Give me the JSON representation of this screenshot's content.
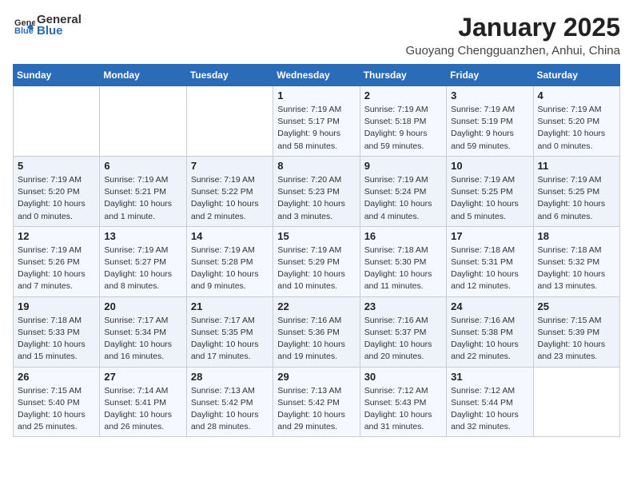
{
  "header": {
    "logo_line1": "General",
    "logo_line2": "Blue",
    "month_title": "January 2025",
    "location": "Guoyang Chengguanzhen, Anhui, China"
  },
  "weekdays": [
    "Sunday",
    "Monday",
    "Tuesday",
    "Wednesday",
    "Thursday",
    "Friday",
    "Saturday"
  ],
  "weeks": [
    [
      {
        "day": "",
        "info": ""
      },
      {
        "day": "",
        "info": ""
      },
      {
        "day": "",
        "info": ""
      },
      {
        "day": "1",
        "info": "Sunrise: 7:19 AM\nSunset: 5:17 PM\nDaylight: 9 hours and 58 minutes."
      },
      {
        "day": "2",
        "info": "Sunrise: 7:19 AM\nSunset: 5:18 PM\nDaylight: 9 hours and 59 minutes."
      },
      {
        "day": "3",
        "info": "Sunrise: 7:19 AM\nSunset: 5:19 PM\nDaylight: 9 hours and 59 minutes."
      },
      {
        "day": "4",
        "info": "Sunrise: 7:19 AM\nSunset: 5:20 PM\nDaylight: 10 hours and 0 minutes."
      }
    ],
    [
      {
        "day": "5",
        "info": "Sunrise: 7:19 AM\nSunset: 5:20 PM\nDaylight: 10 hours and 0 minutes."
      },
      {
        "day": "6",
        "info": "Sunrise: 7:19 AM\nSunset: 5:21 PM\nDaylight: 10 hours and 1 minute."
      },
      {
        "day": "7",
        "info": "Sunrise: 7:19 AM\nSunset: 5:22 PM\nDaylight: 10 hours and 2 minutes."
      },
      {
        "day": "8",
        "info": "Sunrise: 7:20 AM\nSunset: 5:23 PM\nDaylight: 10 hours and 3 minutes."
      },
      {
        "day": "9",
        "info": "Sunrise: 7:19 AM\nSunset: 5:24 PM\nDaylight: 10 hours and 4 minutes."
      },
      {
        "day": "10",
        "info": "Sunrise: 7:19 AM\nSunset: 5:25 PM\nDaylight: 10 hours and 5 minutes."
      },
      {
        "day": "11",
        "info": "Sunrise: 7:19 AM\nSunset: 5:25 PM\nDaylight: 10 hours and 6 minutes."
      }
    ],
    [
      {
        "day": "12",
        "info": "Sunrise: 7:19 AM\nSunset: 5:26 PM\nDaylight: 10 hours and 7 minutes."
      },
      {
        "day": "13",
        "info": "Sunrise: 7:19 AM\nSunset: 5:27 PM\nDaylight: 10 hours and 8 minutes."
      },
      {
        "day": "14",
        "info": "Sunrise: 7:19 AM\nSunset: 5:28 PM\nDaylight: 10 hours and 9 minutes."
      },
      {
        "day": "15",
        "info": "Sunrise: 7:19 AM\nSunset: 5:29 PM\nDaylight: 10 hours and 10 minutes."
      },
      {
        "day": "16",
        "info": "Sunrise: 7:18 AM\nSunset: 5:30 PM\nDaylight: 10 hours and 11 minutes."
      },
      {
        "day": "17",
        "info": "Sunrise: 7:18 AM\nSunset: 5:31 PM\nDaylight: 10 hours and 12 minutes."
      },
      {
        "day": "18",
        "info": "Sunrise: 7:18 AM\nSunset: 5:32 PM\nDaylight: 10 hours and 13 minutes."
      }
    ],
    [
      {
        "day": "19",
        "info": "Sunrise: 7:18 AM\nSunset: 5:33 PM\nDaylight: 10 hours and 15 minutes."
      },
      {
        "day": "20",
        "info": "Sunrise: 7:17 AM\nSunset: 5:34 PM\nDaylight: 10 hours and 16 minutes."
      },
      {
        "day": "21",
        "info": "Sunrise: 7:17 AM\nSunset: 5:35 PM\nDaylight: 10 hours and 17 minutes."
      },
      {
        "day": "22",
        "info": "Sunrise: 7:16 AM\nSunset: 5:36 PM\nDaylight: 10 hours and 19 minutes."
      },
      {
        "day": "23",
        "info": "Sunrise: 7:16 AM\nSunset: 5:37 PM\nDaylight: 10 hours and 20 minutes."
      },
      {
        "day": "24",
        "info": "Sunrise: 7:16 AM\nSunset: 5:38 PM\nDaylight: 10 hours and 22 minutes."
      },
      {
        "day": "25",
        "info": "Sunrise: 7:15 AM\nSunset: 5:39 PM\nDaylight: 10 hours and 23 minutes."
      }
    ],
    [
      {
        "day": "26",
        "info": "Sunrise: 7:15 AM\nSunset: 5:40 PM\nDaylight: 10 hours and 25 minutes."
      },
      {
        "day": "27",
        "info": "Sunrise: 7:14 AM\nSunset: 5:41 PM\nDaylight: 10 hours and 26 minutes."
      },
      {
        "day": "28",
        "info": "Sunrise: 7:13 AM\nSunset: 5:42 PM\nDaylight: 10 hours and 28 minutes."
      },
      {
        "day": "29",
        "info": "Sunrise: 7:13 AM\nSunset: 5:42 PM\nDaylight: 10 hours and 29 minutes."
      },
      {
        "day": "30",
        "info": "Sunrise: 7:12 AM\nSunset: 5:43 PM\nDaylight: 10 hours and 31 minutes."
      },
      {
        "day": "31",
        "info": "Sunrise: 7:12 AM\nSunset: 5:44 PM\nDaylight: 10 hours and 32 minutes."
      },
      {
        "day": "",
        "info": ""
      }
    ]
  ]
}
